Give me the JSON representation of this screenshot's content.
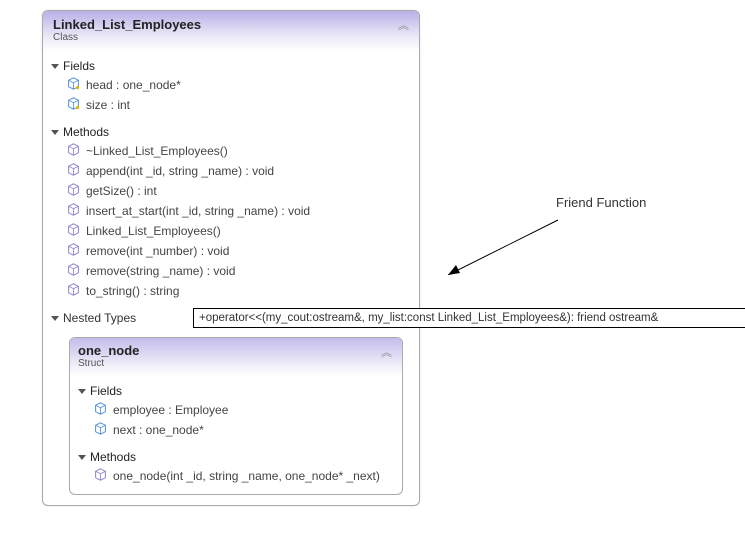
{
  "class": {
    "name": "Linked_List_Employees",
    "kind": "Class",
    "sections": {
      "fields_title": "Fields",
      "methods_title": "Methods",
      "nested_title": "Nested Types"
    },
    "fields": [
      {
        "label": "head : one_node*"
      },
      {
        "label": "size : int"
      }
    ],
    "methods": [
      {
        "label": "~Linked_List_Employees()"
      },
      {
        "label": "append(int _id, string _name) : void"
      },
      {
        "label": "getSize() : int"
      },
      {
        "label": "insert_at_start(int _id, string _name) : void"
      },
      {
        "label": "Linked_List_Employees()"
      },
      {
        "label": "remove(int _number) : void"
      },
      {
        "label": "remove(string _name) : void"
      },
      {
        "label": "to_string() : string"
      }
    ],
    "friend_signature": "+operator<<(my_cout:ostream&, my_list:const Linked_List_Employees&): friend ostream&"
  },
  "struct": {
    "name": "one_node",
    "kind": "Struct",
    "fields_title": "Fields",
    "methods_title": "Methods",
    "fields": [
      {
        "label": "employee : Employee"
      },
      {
        "label": "next : one_node*"
      }
    ],
    "methods": [
      {
        "label": "one_node(int _id, string _name, one_node* _next)"
      }
    ]
  },
  "annotation": {
    "label": "Friend Function"
  }
}
